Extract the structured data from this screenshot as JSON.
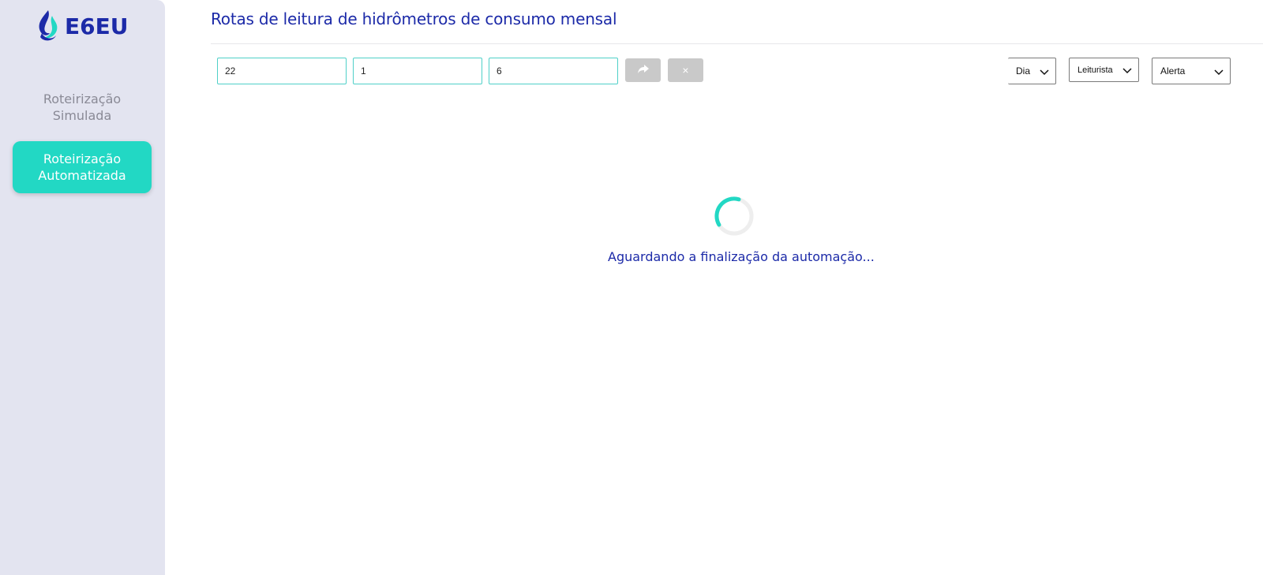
{
  "brand": {
    "name": "E6EU",
    "primary_color": "#1c2aa8",
    "accent_color": "#22d8c4",
    "logo_icon": "water-drop-logo-icon"
  },
  "sidebar": {
    "items": [
      {
        "label": "Roteirização Simulada",
        "active": false
      },
      {
        "label": "Roteirização Automatizada",
        "active": true
      }
    ]
  },
  "main": {
    "title": "Rotas de leitura de hidrômetros de consumo mensal",
    "filters": {
      "fields": [
        {
          "value": "22"
        },
        {
          "value": "1"
        },
        {
          "value": "6"
        }
      ],
      "send_icon": "share-arrow-icon",
      "clear_icon": "close-icon",
      "clear_label": "×",
      "selects": {
        "dia": "Dia",
        "leiturista": "Leiturista",
        "alerta": "Alerta"
      }
    },
    "status": {
      "spinner_icon": "loading-spinner-icon",
      "message": "Aguardando a finalização da automação..."
    }
  }
}
